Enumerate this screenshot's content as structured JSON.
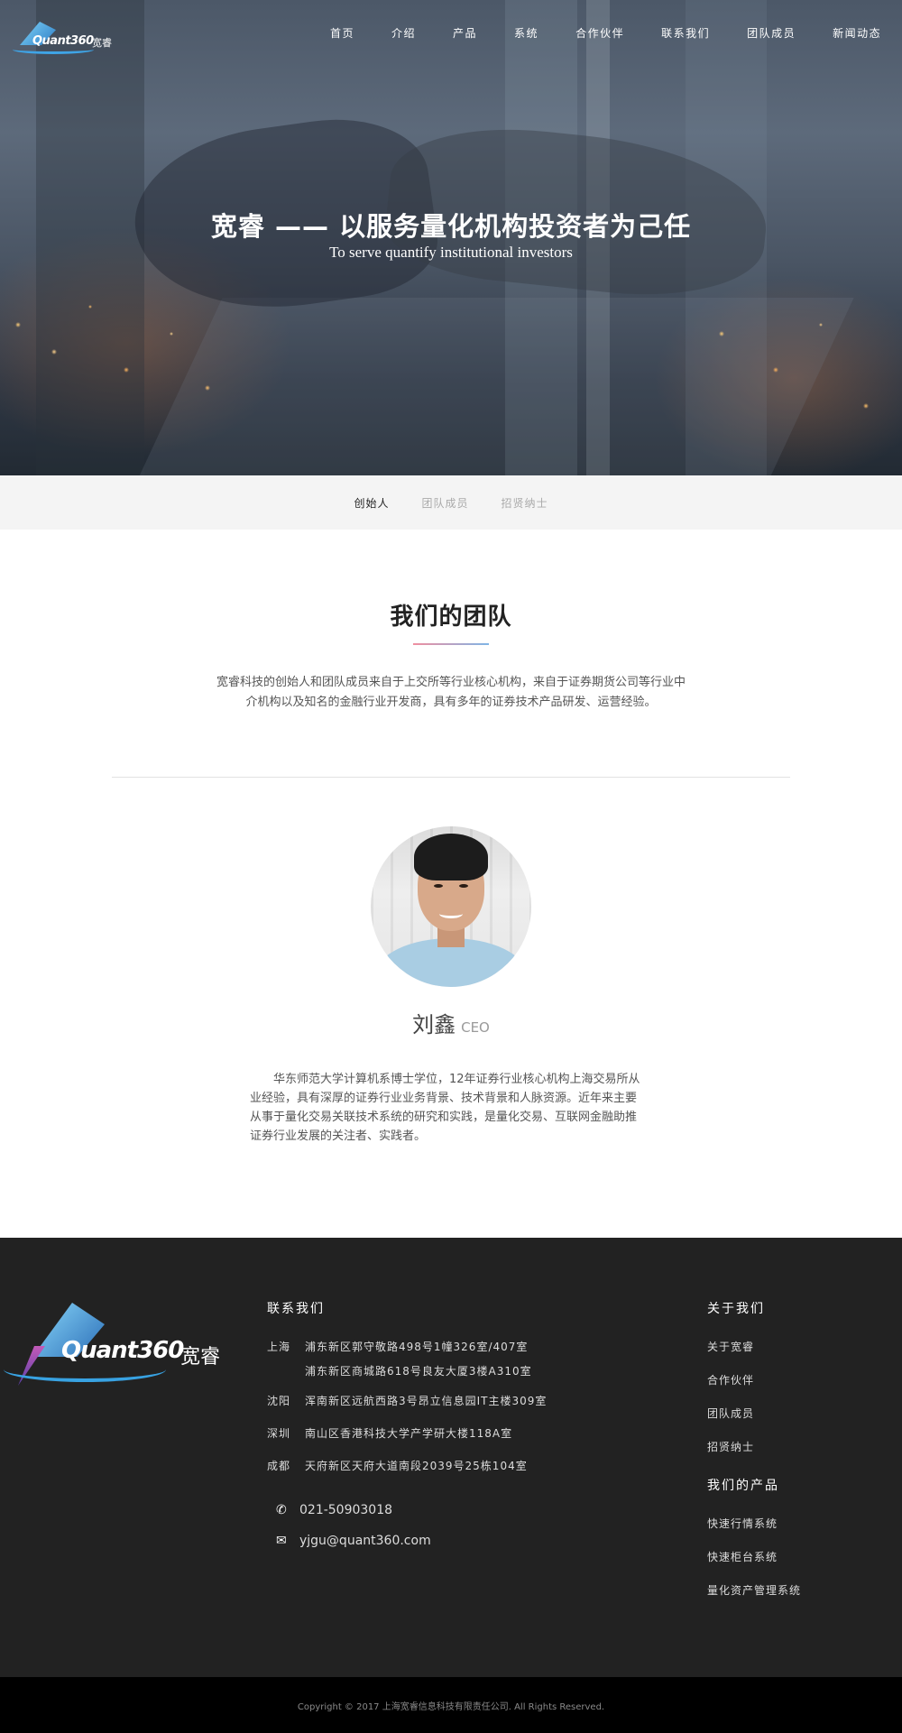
{
  "brand": {
    "logo_text": "Quant360",
    "logo_cn": "宽睿"
  },
  "nav": {
    "items": [
      {
        "label": "首页"
      },
      {
        "label": "介绍"
      },
      {
        "label": "产品"
      },
      {
        "label": "系统"
      },
      {
        "label": "合作伙伴"
      },
      {
        "label": "联系我们"
      },
      {
        "label": "团队成员"
      },
      {
        "label": "新闻动态"
      }
    ]
  },
  "hero": {
    "title": "宽睿 —— 以服务量化机构投资者为己任",
    "subtitle": "To serve quantify institutional investors"
  },
  "tabs": {
    "items": [
      {
        "label": "创始人",
        "active": true
      },
      {
        "label": "团队成员",
        "active": false
      },
      {
        "label": "招贤纳士",
        "active": false
      }
    ]
  },
  "team": {
    "title": "我们的团队",
    "description": "宽睿科技的创始人和团队成员来自于上交所等行业核心机构，来自于证券期货公司等行业中介机构以及知名的金融行业开发商，具有多年的证券技术产品研发、运营经验。"
  },
  "member": {
    "name": "刘鑫",
    "role": "CEO",
    "bio": "华东师范大学计算机系博士学位，12年证券行业核心机构上海交易所从业经验，具有深厚的证券行业业务背景、技术背景和人脉资源。近年来主要从事于量化交易关联技术系统的研究和实践，是量化交易、互联网金融助推证券行业发展的关注者、实践者。"
  },
  "footer": {
    "contact_title": "联系我们",
    "addresses": [
      {
        "city": "上海",
        "line1": "浦东新区郭守敬路498号1幢326室/407室",
        "line2": "浦东新区商城路618号良友大厦3楼A310室"
      },
      {
        "city": "沈阳",
        "line1": "浑南新区远航西路3号昂立信息园IT主楼309室"
      },
      {
        "city": "深圳",
        "line1": "南山区香港科技大学产学研大楼118A室"
      },
      {
        "city": "成都",
        "line1": "天府新区天府大道南段2039号25栋104室"
      }
    ],
    "phone": "021-50903018",
    "email": "yjgu@quant360.com",
    "about_title": "关于我们",
    "about_links": [
      "关于宽睿",
      "合作伙伴",
      "团队成员",
      "招贤纳士"
    ],
    "products_title": "我们的产品",
    "product_links": [
      "快速行情系统",
      "快速柜台系统",
      "量化资产管理系统"
    ],
    "copyright": "Copyright © 2017 上海宽睿信息科技有限责任公司. All Rights Reserved."
  }
}
